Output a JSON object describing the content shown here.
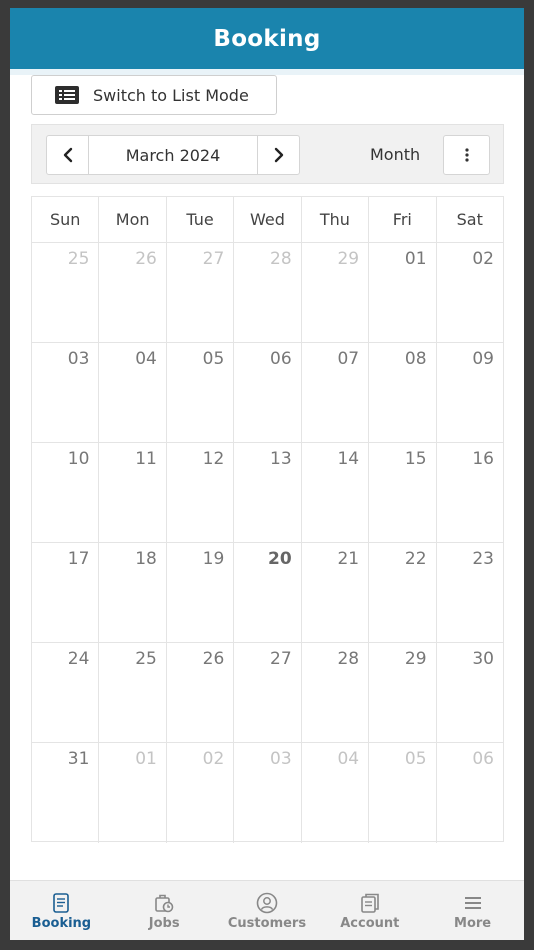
{
  "header": {
    "title": "Booking"
  },
  "switch_button": {
    "label": "Switch to List Mode",
    "icon": "list-icon"
  },
  "toolbar": {
    "title": "March 2024",
    "view": "Month",
    "prev_icon": "chevron-left-icon",
    "next_icon": "chevron-right-icon",
    "more_icon": "kebab-menu-icon"
  },
  "calendar": {
    "days_of_week": [
      "Sun",
      "Mon",
      "Tue",
      "Wed",
      "Thu",
      "Fri",
      "Sat"
    ],
    "weeks": [
      [
        {
          "n": "25",
          "o": true
        },
        {
          "n": "26",
          "o": true
        },
        {
          "n": "27",
          "o": true
        },
        {
          "n": "28",
          "o": true
        },
        {
          "n": "29",
          "o": true
        },
        {
          "n": "01"
        },
        {
          "n": "02"
        }
      ],
      [
        {
          "n": "03"
        },
        {
          "n": "04"
        },
        {
          "n": "05"
        },
        {
          "n": "06"
        },
        {
          "n": "07"
        },
        {
          "n": "08"
        },
        {
          "n": "09"
        }
      ],
      [
        {
          "n": "10"
        },
        {
          "n": "11"
        },
        {
          "n": "12"
        },
        {
          "n": "13"
        },
        {
          "n": "14"
        },
        {
          "n": "15"
        },
        {
          "n": "16"
        }
      ],
      [
        {
          "n": "17"
        },
        {
          "n": "18"
        },
        {
          "n": "19"
        },
        {
          "n": "20",
          "t": true
        },
        {
          "n": "21"
        },
        {
          "n": "22"
        },
        {
          "n": "23"
        }
      ],
      [
        {
          "n": "24"
        },
        {
          "n": "25"
        },
        {
          "n": "26"
        },
        {
          "n": "27"
        },
        {
          "n": "28"
        },
        {
          "n": "29"
        },
        {
          "n": "30"
        }
      ],
      [
        {
          "n": "31"
        },
        {
          "n": "01",
          "o": true
        },
        {
          "n": "02",
          "o": true
        },
        {
          "n": "03",
          "o": true
        },
        {
          "n": "04",
          "o": true
        },
        {
          "n": "05",
          "o": true
        },
        {
          "n": "06",
          "o": true
        }
      ]
    ]
  },
  "tabbar": {
    "items": [
      {
        "label": "Booking",
        "icon": "booking-icon",
        "active": true
      },
      {
        "label": "Jobs",
        "icon": "jobs-icon"
      },
      {
        "label": "Customers",
        "icon": "customers-icon"
      },
      {
        "label": "Account",
        "icon": "account-icon"
      },
      {
        "label": "More",
        "icon": "menu-icon"
      }
    ]
  },
  "colors": {
    "header_bg": "#1a84ad",
    "active_tab": "#1a5e92",
    "inactive_tab": "#888888",
    "other_month_day": "#c4c4c4",
    "current_month_day": "#777777"
  }
}
